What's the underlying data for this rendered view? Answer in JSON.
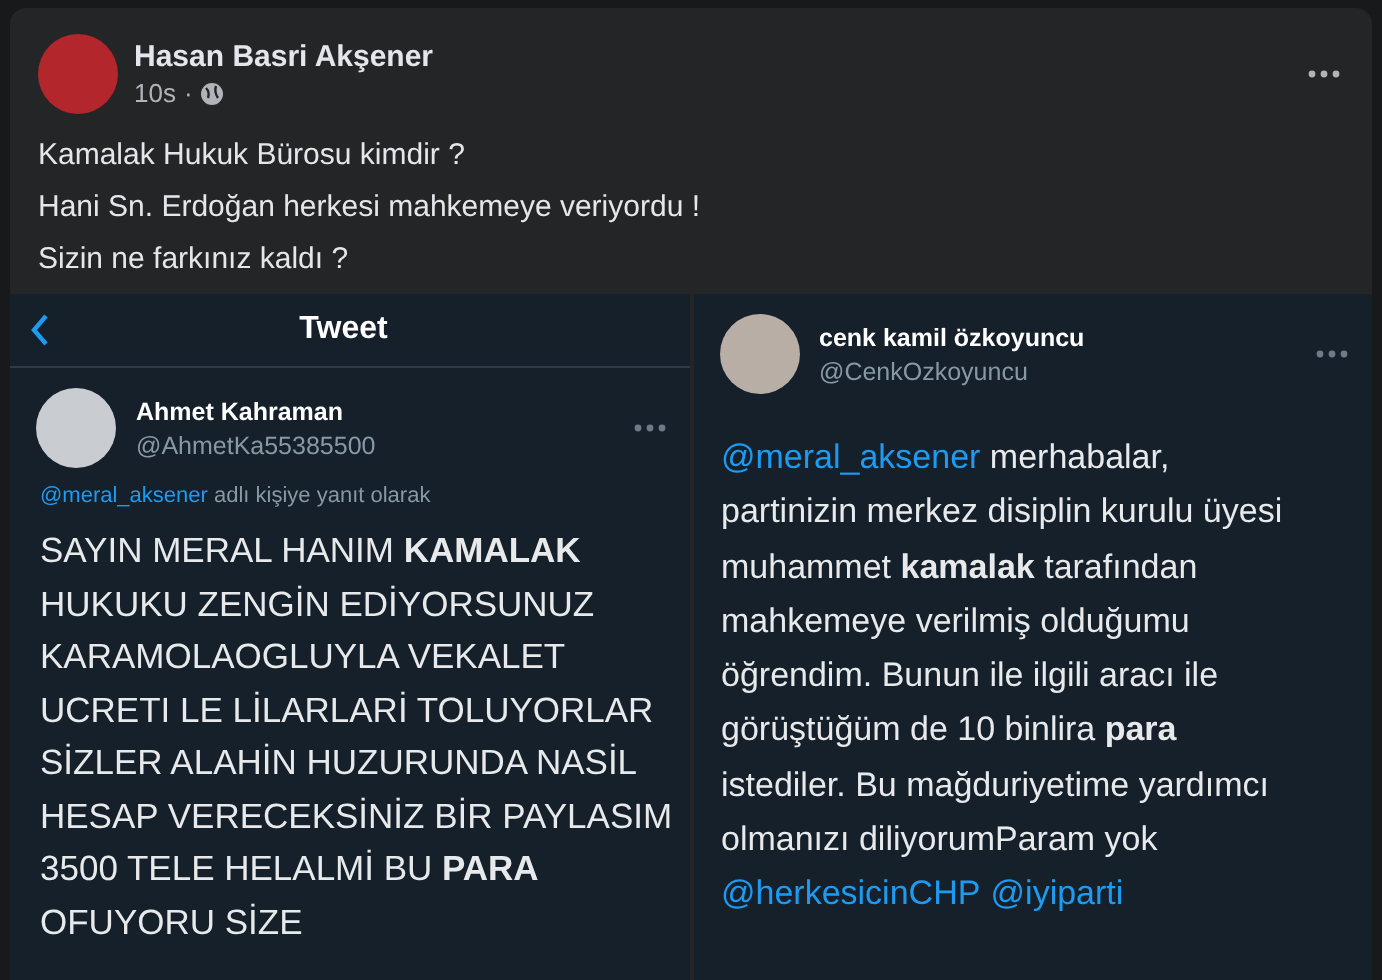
{
  "post": {
    "author": "Hasan Basri Akşener",
    "time": "10s",
    "separator": "·",
    "lines": [
      "Kamalak Hukuk Bürosu kimdir ?",
      "Hani Sn. Erdoğan herkesi mahkemeye veriyordu !",
      "Sizin ne farkınız kaldı ?"
    ]
  },
  "screenshots": [
    {
      "kind": "thread",
      "header_title": "Tweet",
      "name": "Ahmet Kahraman",
      "handle": "@AhmetKa55385500",
      "reply": [
        {
          "kind": "mention",
          "text": "@meral_aksener"
        },
        {
          "kind": "text",
          "text": " adlı kişiye yanıt olarak"
        }
      ],
      "body": [
        {
          "kind": "text",
          "text": "SAYIN MERAL HANIM **KAMALAK**\nHUKUKU ZENGİN EDİYORSUNUZ\nKARAMOLAOGLUYLA VEKALET\nUCRETI LE LİLARLARİ TOLUYORLAR\nSİZLER ALAHİN HUZURUNDA NASİL\nHESAP VERECEKSİNİZ BİR PAYLASIM\n3500 TELE HELALMİ BU **PARA**\nOFUYORU SİZE"
        }
      ]
    },
    {
      "kind": "single",
      "name": "cenk kamil özkoyuncu",
      "handle": "@CenkOzkoyuncu",
      "body": [
        {
          "kind": "mention",
          "text": "@meral_aksener"
        },
        {
          "kind": "text",
          "text": " merhabalar,\npartinizin merkez disiplin kurulu üyesi\nmuhammet **kamalak** tarafından\nmahkemeye verilmiş olduğumu\nöğrendim. Bunun ile ilgili aracı ile\ngörüştüğüm de 10 binlira **para**\nistediler. Bu mağduriyetime yardımcı\nolmanızı diliyorumParam yok\n"
        },
        {
          "kind": "mention",
          "text": "@herkesicinCHP"
        },
        {
          "kind": "mention",
          "text": "@iyiparti"
        }
      ]
    }
  ]
}
